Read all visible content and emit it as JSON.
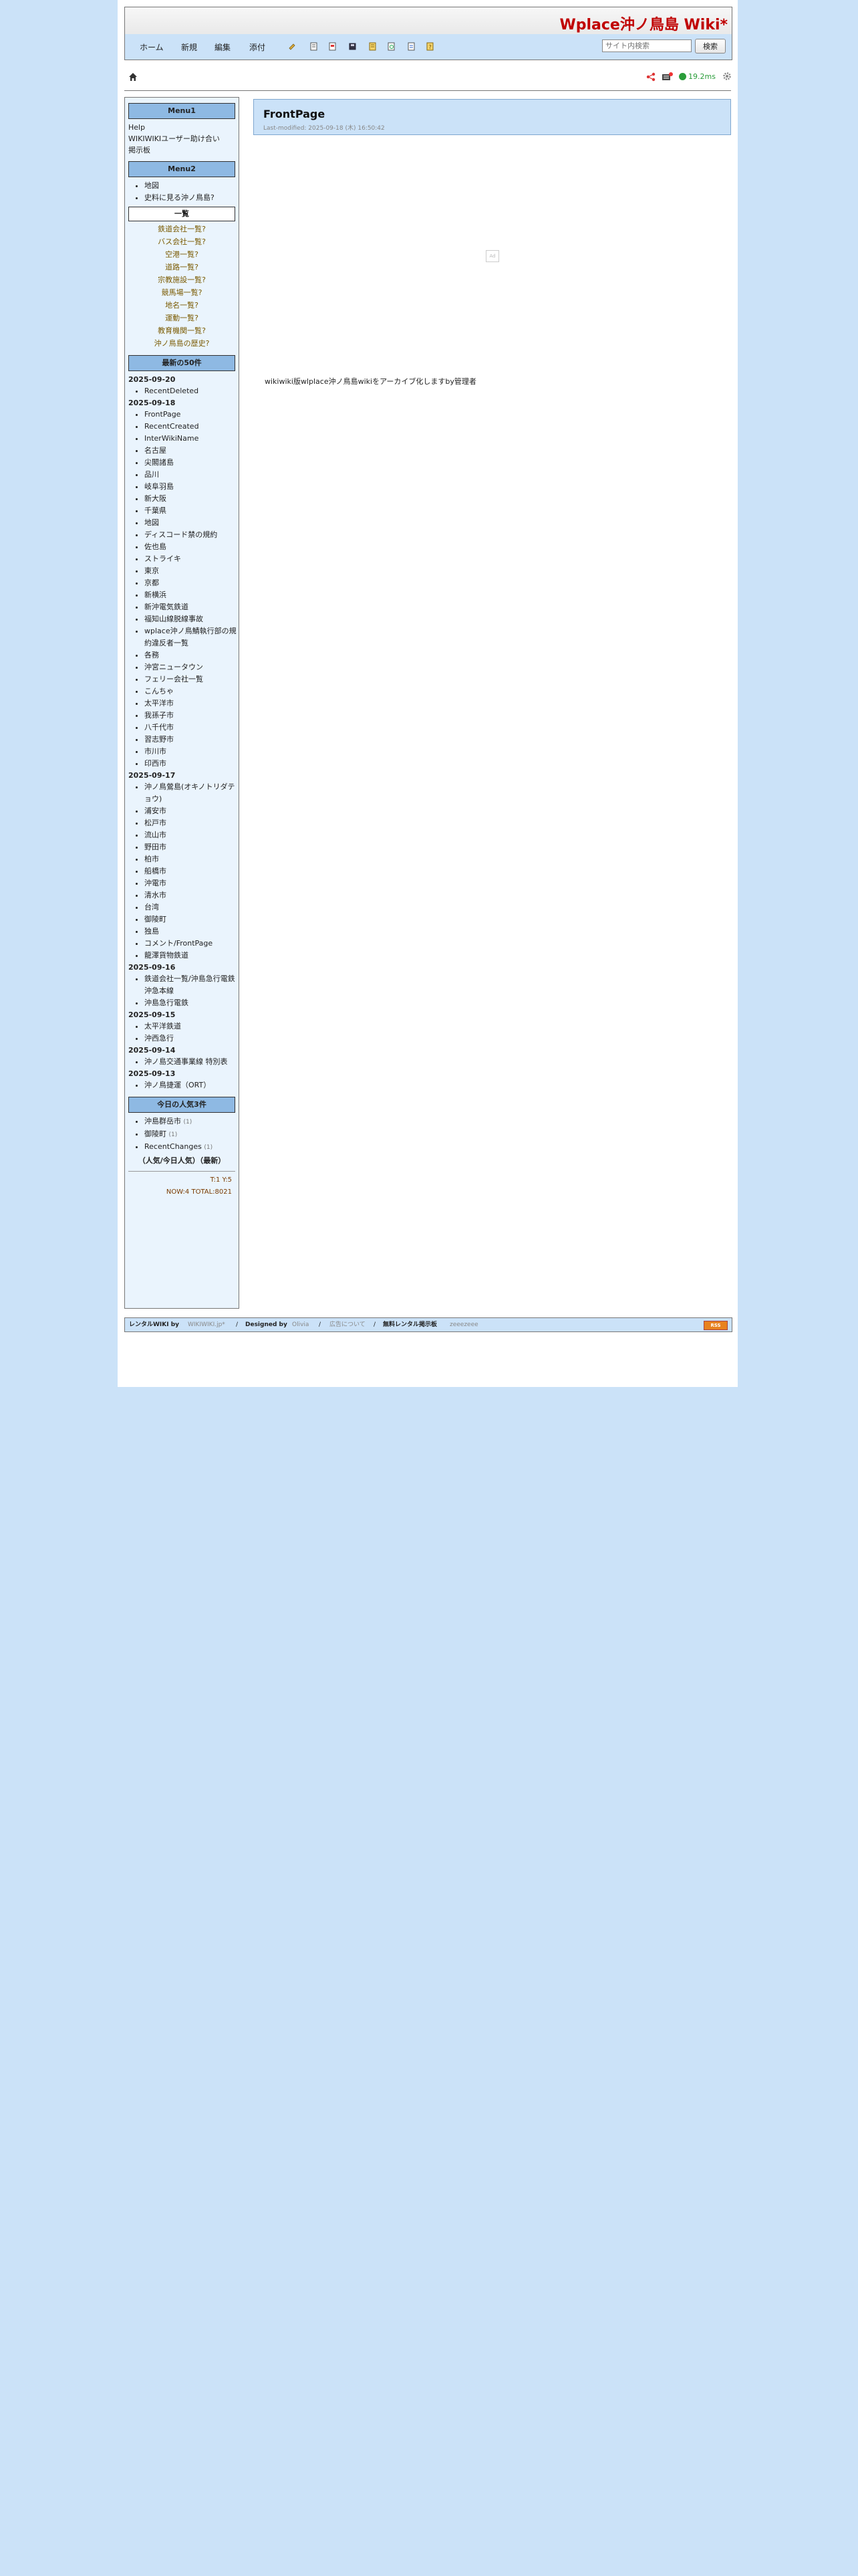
{
  "site": {
    "title": "Wplace沖ノ鳥島 Wiki*"
  },
  "nav": {
    "items": [
      "ホーム",
      "新規",
      "編集",
      "添付"
    ],
    "search_placeholder": "サイト内検索",
    "search_button": "検索"
  },
  "toolbar2": {
    "timer": "19.2ms"
  },
  "sidebar": {
    "menu1": {
      "title": "Menu1",
      "links": [
        "Help",
        "WIKIWIKIユーザー助け合い",
        "掲示板"
      ]
    },
    "menu2": {
      "title": "Menu2",
      "items": [
        "地図",
        "史料に見る沖ノ鳥島?"
      ]
    },
    "ichiran": {
      "title": "一覧",
      "items": [
        "鉄道会社一覧?",
        "バス会社一覧?",
        "空港一覧?",
        "道路一覧?",
        "宗教施設一覧?",
        "競馬場一覧?",
        "地名一覧?",
        "運動一覧?",
        "教育機関一覧?",
        "沖ノ鳥島の歴史?"
      ]
    },
    "recent": {
      "title": "最新の50件",
      "groups": [
        {
          "date": "2025-09-20",
          "items": [
            "RecentDeleted"
          ]
        },
        {
          "date": "2025-09-18",
          "items": [
            "FrontPage",
            "RecentCreated",
            "InterWikiName",
            "名古屋",
            "尖閣諸島",
            "品川",
            "岐阜羽島",
            "新大阪",
            "千葉県",
            "地図",
            "ディスコード禁の規約",
            "佐也島",
            "ストライキ",
            "東京",
            "京都",
            "新横浜",
            "新沖電気鉄道",
            "福知山線脱線事故",
            "wplace沖ノ鳥鯖執行部の規約違反者一覧",
            "各務",
            "沖宮ニュータウン",
            "フェリー会社一覧",
            "こんちゃ",
            "太平洋市",
            "我孫子市",
            "八千代市",
            "習志野市",
            "市川市",
            "印西市"
          ]
        },
        {
          "date": "2025-09-17",
          "items": [
            "沖ノ鳥鶯島(オキノトリダテョウ)",
            "浦安市",
            "松戸市",
            "流山市",
            "野田市",
            "柏市",
            "船橋市",
            "沖電市",
            "清水市",
            "台湾",
            "御陵町",
            "独島",
            "コメント/FrontPage",
            "龍澤貨物鉄道"
          ]
        },
        {
          "date": "2025-09-16",
          "items": [
            "鉄道会社一覧/沖島急行電鉄 沖急本線",
            "沖島急行電鉄"
          ]
        },
        {
          "date": "2025-09-15",
          "items": [
            "太平洋鉄道",
            "沖西急行"
          ]
        },
        {
          "date": "2025-09-14",
          "items": [
            "沖ノ島交通事業線 特別表"
          ]
        },
        {
          "date": "2025-09-13",
          "items": [
            "沖ノ鳥捷運（ORT）"
          ]
        }
      ]
    },
    "ranking": {
      "title": "今日の人気3件",
      "items": [
        {
          "name": "沖島群岳市",
          "count": "(1)"
        },
        {
          "name": "御陵町",
          "count": "(1)"
        },
        {
          "name": "RecentChanges",
          "count": "(1)"
        }
      ],
      "note": "（人気/今日人気）（最新）"
    },
    "counter": {
      "line1": "T:1   Y:5",
      "line2": "NOW:4    TOTAL:8021"
    }
  },
  "main": {
    "title": "FrontPage",
    "last_modified": "Last-modified: 2025-09-18 (木) 16:50:42",
    "ad_label": "Ad",
    "body": "wikiwiki版wlplace沖ノ鳥島wikiをアーカイブ化しますby管理者"
  },
  "footer": {
    "rental": "レンタルWIKI by",
    "wikiwiki": "WIKIWIKI.jp*",
    "sep1": "/",
    "designed": "Designed by",
    "olivia": "Olivia",
    "sep2": "/",
    "ad_about": "広告について",
    "sep3": "/",
    "free_rental": "無料レンタル掲示板",
    "zeeezeee": "zeeezeee",
    "badge": "RSS"
  },
  "colors": {
    "background": "#cbe2f8",
    "title_red": "#c00000",
    "sidebar_head": "#8eb9e3",
    "timer_green": "#2a9d3a"
  }
}
